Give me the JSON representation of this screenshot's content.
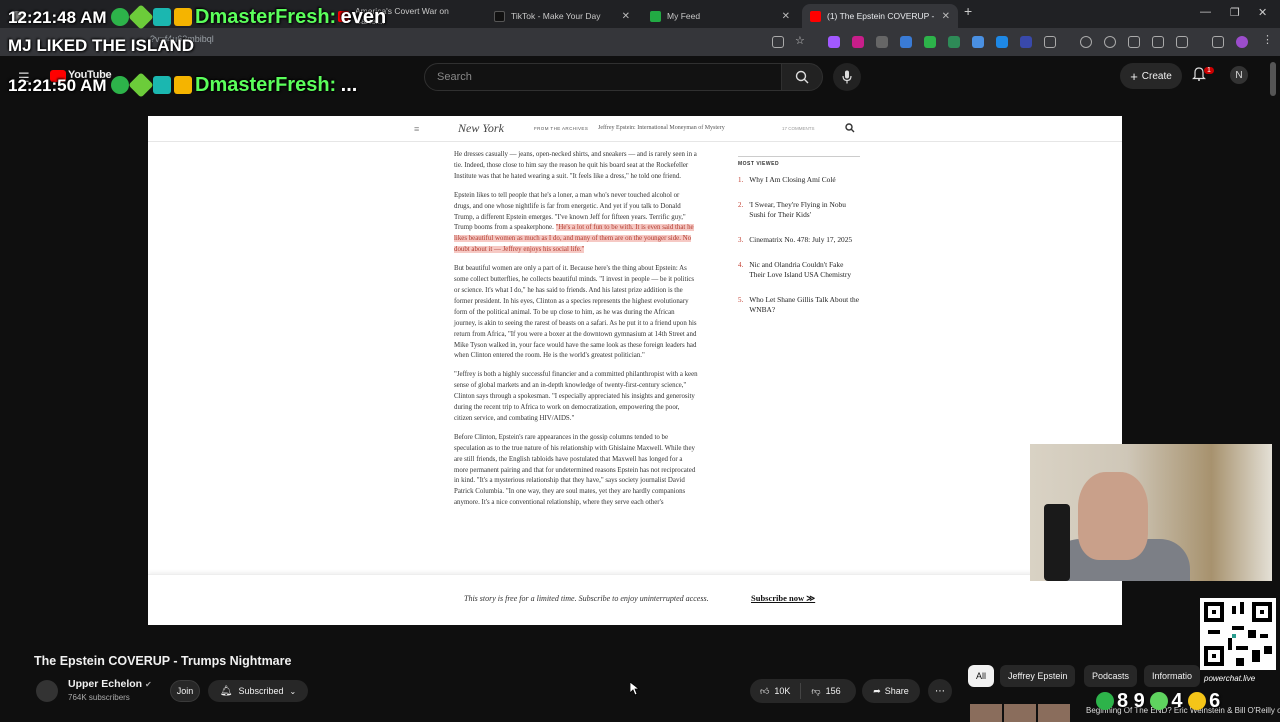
{
  "browser": {
    "tabs": [
      {
        "label": "",
        "color": "#888"
      },
      {
        "label": "America's Covert War on Cartel...",
        "color": "#ff0000"
      },
      {
        "label": "TikTok - Make Your Day",
        "color": "#111111"
      },
      {
        "label": "My Feed",
        "color": "#22aa44"
      },
      {
        "label": "(1) The Epstein COVERUP -",
        "color": "#ff0000"
      }
    ],
    "url": "?v=f4u62mbibql",
    "new_tab": "+"
  },
  "youtube": {
    "logo": "YouTube",
    "search_placeholder": "Search",
    "create_label": "Create",
    "notif_count": "1",
    "account_initial": "N"
  },
  "chat": {
    "lines": [
      {
        "time": "12:21:48 AM",
        "user": "DmasterFresh:",
        "message": "even"
      },
      {
        "time": "",
        "user": "",
        "message": "MJ LIKED THE ISLAND"
      },
      {
        "time": "12:21:50 AM",
        "user": "DmasterFresh:",
        "message": "..."
      }
    ]
  },
  "article": {
    "masthead": "New York",
    "from_archives": "FROM THE ARCHIVES",
    "headline": "Jeffrey Epstein: International Moneyman of Mystery",
    "comments": "17 COMMENTS",
    "p1": "He dresses casually — jeans, open-necked shirts, and sneakers — and is rarely seen in a tie. Indeed, those close to him say the reason he quit his board seat at the Rockefeller Institute was that he hated wearing a suit. \"It feels like a dress,\" he told one friend.",
    "p2a": "Epstein likes to tell people that he's a loner, a man who's never touched alcohol or drugs, and one whose nightlife is far from energetic. And yet if you talk to Donald Trump, a different Epstein emerges. \"I've known Jeff for fifteen years. Terrific guy,\" Trump booms from a speakerphone. ",
    "p2b": "\"He's a lot of fun to be with. It is even said that he likes beautiful women as much as I do, and many of them are on the younger side. No doubt about it — Jeffrey enjoys his social life.\"",
    "p3": "But beautiful women are only a part of it. Because here's the thing about Epstein: As some collect butterflies, he collects beautiful minds. \"I invest in people — be it politics or science. It's what I do,\" he has said to friends. And his latest prize addition is the former president. In his eyes, Clinton as a species represents the highest evolutionary form of the political animal. To be up close to him, as he was during the African journey, is akin to seeing the rarest of beasts on a safari. As he put it to a friend upon his return from Africa, \"If you were a boxer at the downtown gymnasium at 14th Street and Mike Tyson walked in, your face would have the same look as these foreign leaders had when Clinton entered the room. He is the world's greatest politician.\"",
    "p4": "\"Jeffrey is both a highly successful financier and a committed philanthropist with a keen sense of global markets and an in-depth knowledge of twenty-first-century science,\" Clinton says through a spokesman. \"I especially appreciated his insights and generosity during the recent trip to Africa to work on democratization, empowering the poor, citizen service, and combating HIV/AIDS.\"",
    "p5": "Before Clinton, Epstein's rare appearances in the gossip columns tended to be speculation as to the true nature of his relationship with Ghislaine Maxwell. While they are still friends, the English tabloids have postulated that Maxwell has longed for a more permanent pairing and that for undetermined reasons Epstein has not reciprocated in kind. \"It's a mysterious relationship that they have,\" says society journalist David Patrick Columbia. \"In one way, they are soul mates, yet they are hardly companions anymore. It's a nice conventional relationship, where they serve each other's",
    "most_viewed_title": "MOST VIEWED",
    "most_viewed": [
      {
        "num": "1.",
        "title": "Why I Am Closing Amí Colé"
      },
      {
        "num": "2.",
        "title": "'I Swear, They're Flying in Nobu Sushi for Their Kids'"
      },
      {
        "num": "3.",
        "title": "Cinematrix No. 478: July 17, 2025"
      },
      {
        "num": "4.",
        "title": "Nic and Olandria Couldn't Fake Their Love Island USA Chemistry"
      },
      {
        "num": "5.",
        "title": "Who Let Shane Gillis Talk About the WNBA?"
      }
    ],
    "paywall_text": "This story is free for a limited time. Subscribe to enjoy uninterrupted access.",
    "paywall_link": "Subscribe now ≫"
  },
  "video": {
    "title": "The Epstein COVERUP - Trumps Nightmare",
    "channel": "Upper Echelon",
    "subscribers": "764K subscribers",
    "join_label": "Join",
    "subscribed_label": "Subscribed",
    "likes": "10K",
    "dislikes": "156",
    "share_label": "Share",
    "more_label": "⋯"
  },
  "chips": [
    "All",
    "Jeffrey Epstein",
    "Podcasts",
    "Informatio"
  ],
  "overlay": {
    "powerchat": "powerchat.live",
    "counter_a": "8 9",
    "counter_b": "4",
    "counter_c": "6",
    "recommended_title": "Beginning Of The END? Eric Weinstein & Bill O'Reilly o"
  },
  "colors": {
    "accent_red": "#cc0000",
    "highlight": "#f6c9c4",
    "chat_user": "#5bff5b"
  }
}
